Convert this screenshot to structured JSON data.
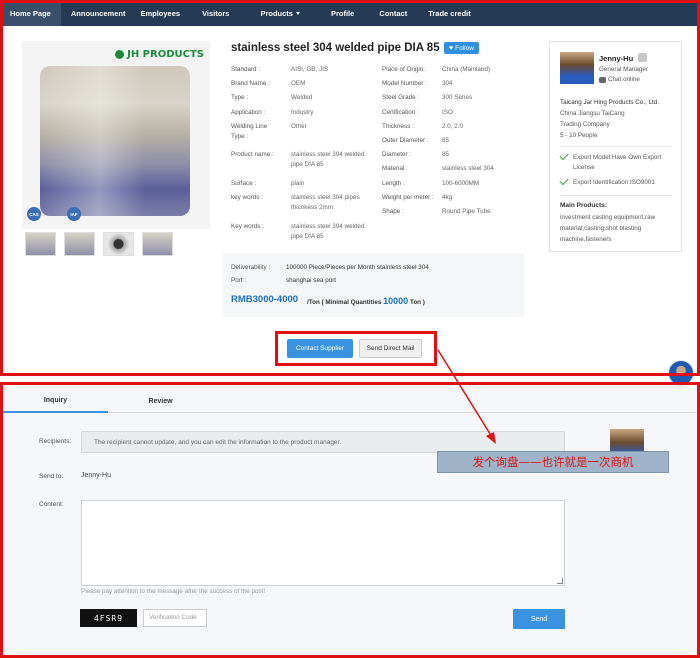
{
  "nav": {
    "items": [
      "Home Page",
      "Announcement",
      "Employees",
      "Visitors",
      "Products",
      "Profile",
      "Contact",
      "Trade credit"
    ]
  },
  "product": {
    "title": "stainless steel 304 welded pipe DIA 85",
    "follow_label": "Follow",
    "brand_logo_text": "JH PRODUCTS",
    "cert_badges": [
      "CAS",
      "IAF"
    ],
    "specs_left": [
      {
        "k": "Standard :",
        "v": "AISI, GB, JIS"
      },
      {
        "k": "Brand Name :",
        "v": "OEM"
      },
      {
        "k": "Type :",
        "v": "Welded"
      },
      {
        "k": "Application :",
        "v": "Industry"
      },
      {
        "k": "Welding Line Type :",
        "v": "Other"
      },
      {
        "k": "Product name :",
        "v": "stainless steel 304 welded pipe DIA 85"
      },
      {
        "k": "Surface :",
        "v": "plain"
      },
      {
        "k": "key words :",
        "v": "stainless steel 304 pipes thicnkess 2mm"
      },
      {
        "k": "Key words :",
        "v": "stainless steel 304 welded pipe DIA 85"
      }
    ],
    "specs_right": [
      {
        "k": "Place of Origin :",
        "v": "China (Mainland)"
      },
      {
        "k": "Model Number :",
        "v": "304"
      },
      {
        "k": "Steel Grade :",
        "v": "300 Series"
      },
      {
        "k": "Certification :",
        "v": "ISO"
      },
      {
        "k": "Thickness :",
        "v": "2.0, 2.0"
      },
      {
        "k": "Outer Diameter :",
        "v": "85"
      },
      {
        "k": "Diameter :",
        "v": "85"
      },
      {
        "k": "Material :",
        "v": "stainless steel 304"
      },
      {
        "k": "Length :",
        "v": "100-6000MM"
      },
      {
        "k": "Weight per meter :",
        "v": "4kg"
      },
      {
        "k": "Shape :",
        "v": "Round Pipe Tube"
      }
    ],
    "deliverability_label": "Deliverability :",
    "deliverability_value": "100000 Piece/Pieces per Month stainless steel 304",
    "port_label": "Port :",
    "port_value": "shanghai sea port",
    "price": "RMB3000-4000",
    "price_unit_prefix": "/Ton ( Minimal Quantities",
    "min_qty": "10000",
    "price_unit_suffix": "Ton )",
    "contact_button": "Contact Supplier",
    "mail_button": "Send Direct Mail"
  },
  "supplier": {
    "name": "Jenny-Hu",
    "role": "General Manager",
    "chat": "Chat online",
    "company": "Taicang Jar Hing Products Co., Ltd.",
    "location": "China Jiangsu TaiCang",
    "business_type": "Trading Company",
    "people": "5 - 10 People",
    "features": [
      "Export Model:Have Own Export License",
      "Export Identification:ISO9001"
    ],
    "main_products_title": "Main Products:",
    "main_products": "investment casting equipment,raw material,casting,shot blasting machine,fasteners"
  },
  "inquiry": {
    "tabs": [
      "Inquiry",
      "Review"
    ],
    "recipients_label": "Recipients:",
    "recipients_text": "The recipient cannot update, and you can edit the information to the product manager.",
    "sendto_label": "Send to:",
    "sendto_value": "Jenny-Hu",
    "content_label": "Content:",
    "notice": "Please pay attention to the message after the success of the post!",
    "captcha": "4FSR9",
    "verification_placeholder": "Verification Code",
    "send_button": "Send",
    "avatar_caption": "Jenny-Hu"
  },
  "annotation": {
    "text": "发个询盘——也许就是一次商机",
    "color": "#e01010"
  }
}
